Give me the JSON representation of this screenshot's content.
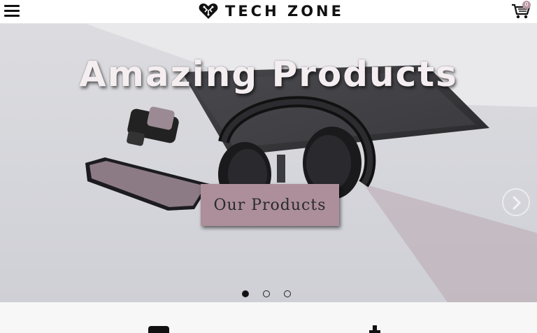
{
  "header": {
    "brand": "TECH ZONE",
    "menu_icon": "hamburger-menu-icon",
    "logo_icon": "heart-circuit-logo",
    "cart_icon": "shopping-cart-icon",
    "cart_count": "0"
  },
  "hero": {
    "title": "Amazing Products",
    "cta_label": "Our Products",
    "next_icon": "chevron-right-icon",
    "slides": {
      "count": 3,
      "active_index": 0
    }
  },
  "colors": {
    "accent": "#ac8f9a",
    "badge": "#b99aa4",
    "title_text": "#f4eef0"
  }
}
